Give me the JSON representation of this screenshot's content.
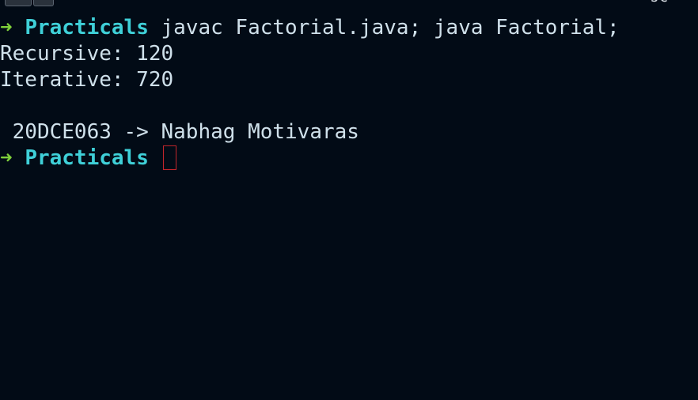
{
  "window": {
    "corner_glyph": "JC"
  },
  "terminal": {
    "prompt_symbol": "➜",
    "directory": "Practicals",
    "command": "javac Factorial.java; java Factorial;",
    "output_lines": [
      "Recursive: 120",
      "Iterative: 720",
      "",
      " 20DCE063 -> Nabhag Motivaras"
    ]
  },
  "colors": {
    "background": "#020b16",
    "prompt_arrow": "#7fd13b",
    "directory": "#3fd0d8",
    "text": "#cfe0ea",
    "cursor_outline": "#c1262b"
  },
  "icons": {
    "prompt": "arrow-right-icon"
  }
}
